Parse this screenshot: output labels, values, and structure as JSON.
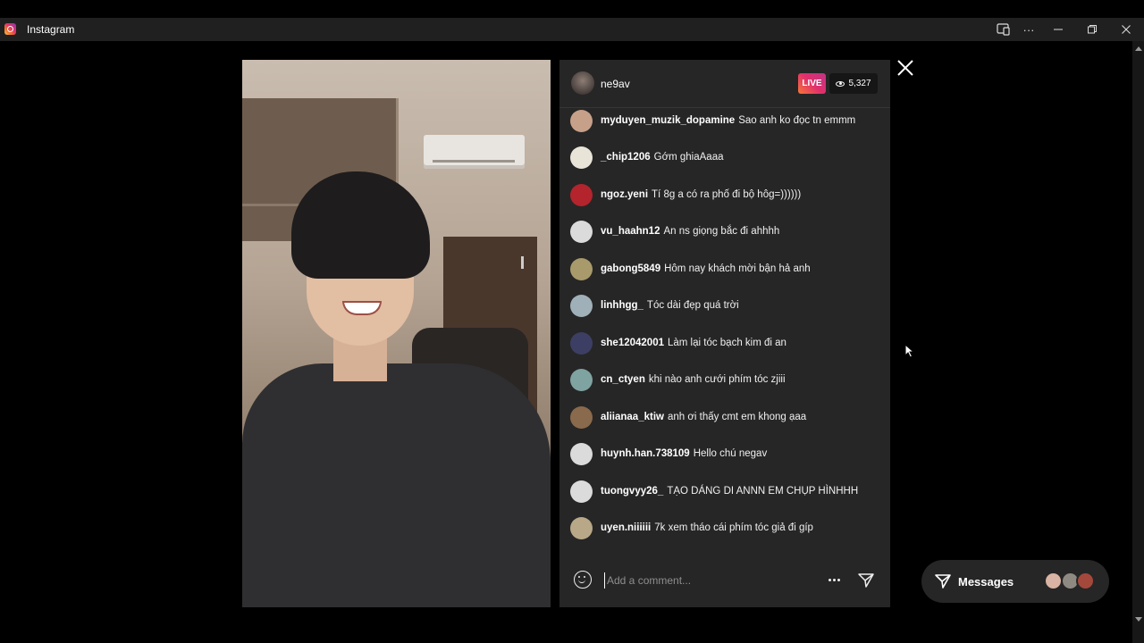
{
  "window": {
    "app_title": "Instagram",
    "controls": [
      "tv-icon",
      "more-icon",
      "minimize-icon",
      "restore-icon",
      "close-icon"
    ],
    "ellipsis": "···"
  },
  "live": {
    "host": "ne9av",
    "badge": "LIVE",
    "viewers": "5,327",
    "badge_gradient": [
      "#f77737",
      "#e1306c",
      "#c13584"
    ]
  },
  "comments": [
    {
      "user": "myduyen_muzik_dopamine",
      "text": "Sao anh ko đọc tn emmm",
      "avatar_color": "#c7a08a"
    },
    {
      "user": "_chip1206",
      "text": "Gớm ghiaAaaa",
      "avatar_color": "#e9e4d8"
    },
    {
      "user": "ngoz.yeni",
      "text": "Tí 8g a có ra phố đi bộ hôg=))))))",
      "avatar_color": "#b3242c"
    },
    {
      "user": "vu_haahn12",
      "text": "An ns giọng bắc đi ahhhh",
      "avatar_color": "#dbdbdb"
    },
    {
      "user": "gabong5849",
      "text": "Hôm nay khách mời bận hả anh",
      "avatar_color": "#a99a6b"
    },
    {
      "user": "linhhgg_",
      "text": "Tóc dài đẹp quá trời",
      "avatar_color": "#9fb0b8"
    },
    {
      "user": "she12042001",
      "text": "Làm lại tóc bạch kim đi an",
      "avatar_color": "#3c3f63"
    },
    {
      "user": "cn_ctyen",
      "text": "khi nào anh cưới phím tóc zjiii",
      "avatar_color": "#7fa3a0"
    },
    {
      "user": "aliianaa_ktiw",
      "text": "anh ơi thấy cmt em khong ạaa",
      "avatar_color": "#8a6a4c"
    },
    {
      "user": "huynh.han.738109",
      "text": "Hello chú negav",
      "avatar_color": "#dbdbdb"
    },
    {
      "user": "tuongvyy26_",
      "text": "TẠO DÁNG DI ANNN EM CHỤP HÌNHHH",
      "avatar_color": "#dbdbdb"
    },
    {
      "user": "uyen.niiiiii",
      "text": "7k xem tháo cái phím tóc giả đi gíp",
      "avatar_color": "#b8a888"
    }
  ],
  "composer": {
    "placeholder": "Add a comment..."
  },
  "messages": {
    "label": "Messages"
  }
}
